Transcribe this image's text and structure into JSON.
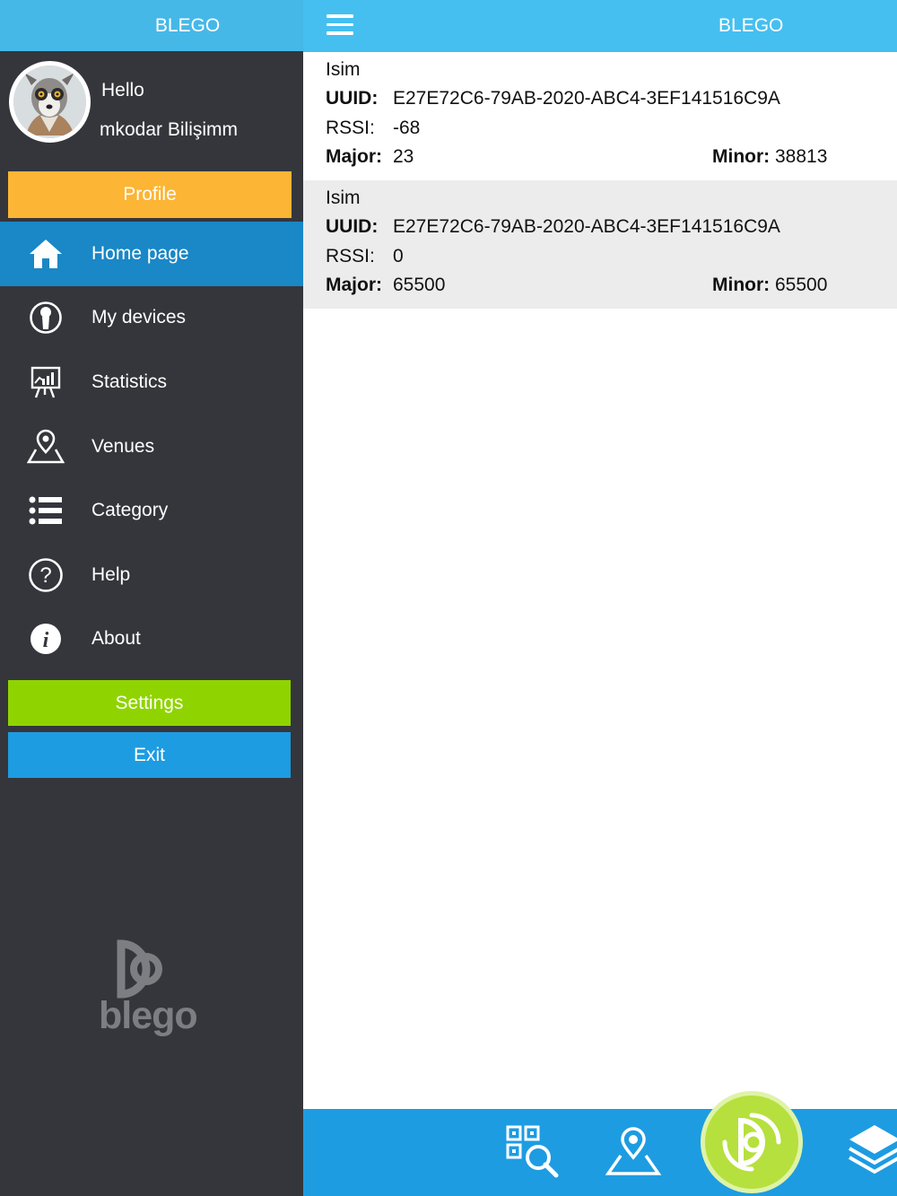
{
  "sidebar": {
    "title": "BLEGO",
    "greeting": "Hello",
    "username": "mkodar Bilişimm",
    "profile_label": "Profile",
    "items": [
      {
        "label": "Home page",
        "icon": "home-icon",
        "active": true
      },
      {
        "label": "My devices",
        "icon": "user-circle-icon",
        "active": false
      },
      {
        "label": "Statistics",
        "icon": "statistics-board-icon",
        "active": false
      },
      {
        "label": "Venues",
        "icon": "map-pin-icon",
        "active": false
      },
      {
        "label": "Category",
        "icon": "list-icon",
        "active": false
      },
      {
        "label": "Help",
        "icon": "question-circle-icon",
        "active": false
      },
      {
        "label": "About",
        "icon": "info-icon",
        "active": false
      }
    ],
    "settings_label": "Settings",
    "exit_label": "Exit",
    "logo_text": "blego"
  },
  "header": {
    "title": "BLEGO"
  },
  "beacons": [
    {
      "name": "Isim",
      "uuid_label": "UUID:",
      "uuid": "E27E72C6-79AB-2020-ABC4-3EF141516C9A",
      "rssi_label": "RSSI:",
      "rssi": "-68",
      "major_label": "Major:",
      "major": "23",
      "minor_label": "Minor:",
      "minor": "38813"
    },
    {
      "name": "Isim",
      "uuid_label": "UUID:",
      "uuid": "E27E72C6-79AB-2020-ABC4-3EF141516C9A",
      "rssi_label": "RSSI:",
      "rssi": "0",
      "major_label": "Major:",
      "major": "65500",
      "minor_label": "Minor:",
      "minor": "65500"
    }
  ],
  "bottom_bar": {
    "icons": [
      "qr-search-icon",
      "map-pin-icon",
      "scan-icon",
      "layers-icon"
    ]
  },
  "colors": {
    "header_blue": "#45bff0",
    "sidebar_bg": "#35363b",
    "active_blue": "#1a87c6",
    "profile_orange": "#fcb534",
    "settings_green": "#8fd400",
    "exit_blue": "#1d9ce2",
    "scan_green": "#b6e03d"
  }
}
